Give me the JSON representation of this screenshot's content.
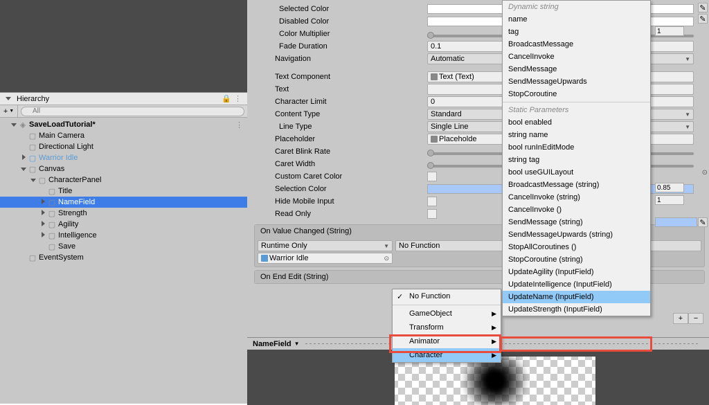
{
  "hierarchy": {
    "tab": "Hierarchy",
    "create": "+",
    "search_placeholder": "All",
    "search_icon": "🔍",
    "tree": [
      {
        "label": "SaveLoadTutorial*",
        "indent": 0,
        "arrow": "down",
        "bold": true,
        "unity": true
      },
      {
        "label": "Main Camera",
        "indent": 1
      },
      {
        "label": "Directional Light",
        "indent": 1
      },
      {
        "label": "Warrior Idle",
        "indent": 1,
        "arrow": "right",
        "blue": true,
        "prefab": true
      },
      {
        "label": "Canvas",
        "indent": 1,
        "arrow": "down"
      },
      {
        "label": "CharacterPanel",
        "indent": 2,
        "arrow": "down"
      },
      {
        "label": "Title",
        "indent": 3
      },
      {
        "label": "NameField",
        "indent": 3,
        "arrow": "right",
        "selected": true
      },
      {
        "label": "Strength",
        "indent": 3,
        "arrow": "right"
      },
      {
        "label": "Agility",
        "indent": 3,
        "arrow": "right"
      },
      {
        "label": "Intelligence",
        "indent": 3,
        "arrow": "right"
      },
      {
        "label": "Save",
        "indent": 3
      },
      {
        "label": "EventSystem",
        "indent": 1
      }
    ]
  },
  "inspector": {
    "rows": [
      {
        "label": "Selected Color",
        "type": "color",
        "sub": true
      },
      {
        "label": "Disabled Color",
        "type": "color",
        "sub": true
      },
      {
        "label": "Color Multiplier",
        "type": "slider",
        "sub": true
      },
      {
        "label": "Fade Duration",
        "type": "text",
        "value": "0.1",
        "sub": true
      },
      {
        "label": "Navigation",
        "type": "dropdown",
        "value": "Automatic"
      },
      {
        "label": "",
        "type": "gap"
      },
      {
        "label": "Text Component",
        "type": "object",
        "value": "Text (Text)"
      },
      {
        "label": "Text",
        "type": "text",
        "value": ""
      },
      {
        "label": "Character Limit",
        "type": "text",
        "value": "0"
      },
      {
        "label": "Content Type",
        "type": "dropdown",
        "value": "Standard"
      },
      {
        "label": "Line Type",
        "type": "dropdown",
        "value": "Single Line",
        "sub": true
      },
      {
        "label": "Placeholder",
        "type": "object",
        "value": "Placeholde"
      },
      {
        "label": "Caret Blink Rate",
        "type": "slider"
      },
      {
        "label": "Caret Width",
        "type": "slider"
      },
      {
        "label": "Custom Caret Color",
        "type": "check"
      },
      {
        "label": "Selection Color",
        "type": "color",
        "blue": true
      },
      {
        "label": "Hide Mobile Input",
        "type": "check"
      },
      {
        "label": "Read Only",
        "type": "check"
      }
    ],
    "event1": {
      "title": "On Value Changed (String)",
      "runtime": "Runtime Only",
      "target": "Warrior Idle",
      "func": "No Function"
    },
    "event2": {
      "title": "On End Edit (String)"
    },
    "footer": "NameField"
  },
  "submenu": {
    "items": [
      {
        "label": "No Function",
        "checked": true
      },
      {
        "sep": true
      },
      {
        "label": "GameObject",
        "arrow": true
      },
      {
        "label": "Transform",
        "arrow": true
      },
      {
        "label": "Animator",
        "arrow": true
      },
      {
        "label": "Character",
        "arrow": true,
        "highlighted": true
      }
    ]
  },
  "funcmenu": {
    "header1": "Dynamic string",
    "group1": [
      "name",
      "tag",
      "BroadcastMessage",
      "CancelInvoke",
      "SendMessage",
      "SendMessageUpwards",
      "StopCoroutine"
    ],
    "header2": "Static Parameters",
    "group2": [
      "bool enabled",
      "string name",
      "bool runInEditMode",
      "string tag",
      "bool useGUILayout",
      "BroadcastMessage (string)",
      "CancelInvoke (string)",
      "CancelInvoke ()",
      "SendMessage (string)",
      "SendMessageUpwards (string)",
      "StopAllCoroutines ()",
      "StopCoroutine (string)",
      "UpdateAgility (InputField)",
      "UpdateIntelligence (InputField)",
      "UpdateName (InputField)",
      "UpdateStrength (InputField)"
    ]
  },
  "right": {
    "val1": "1",
    "val2": "0.85",
    "val3": "1"
  },
  "plusminus": {
    "plus": "+",
    "minus": "−"
  }
}
